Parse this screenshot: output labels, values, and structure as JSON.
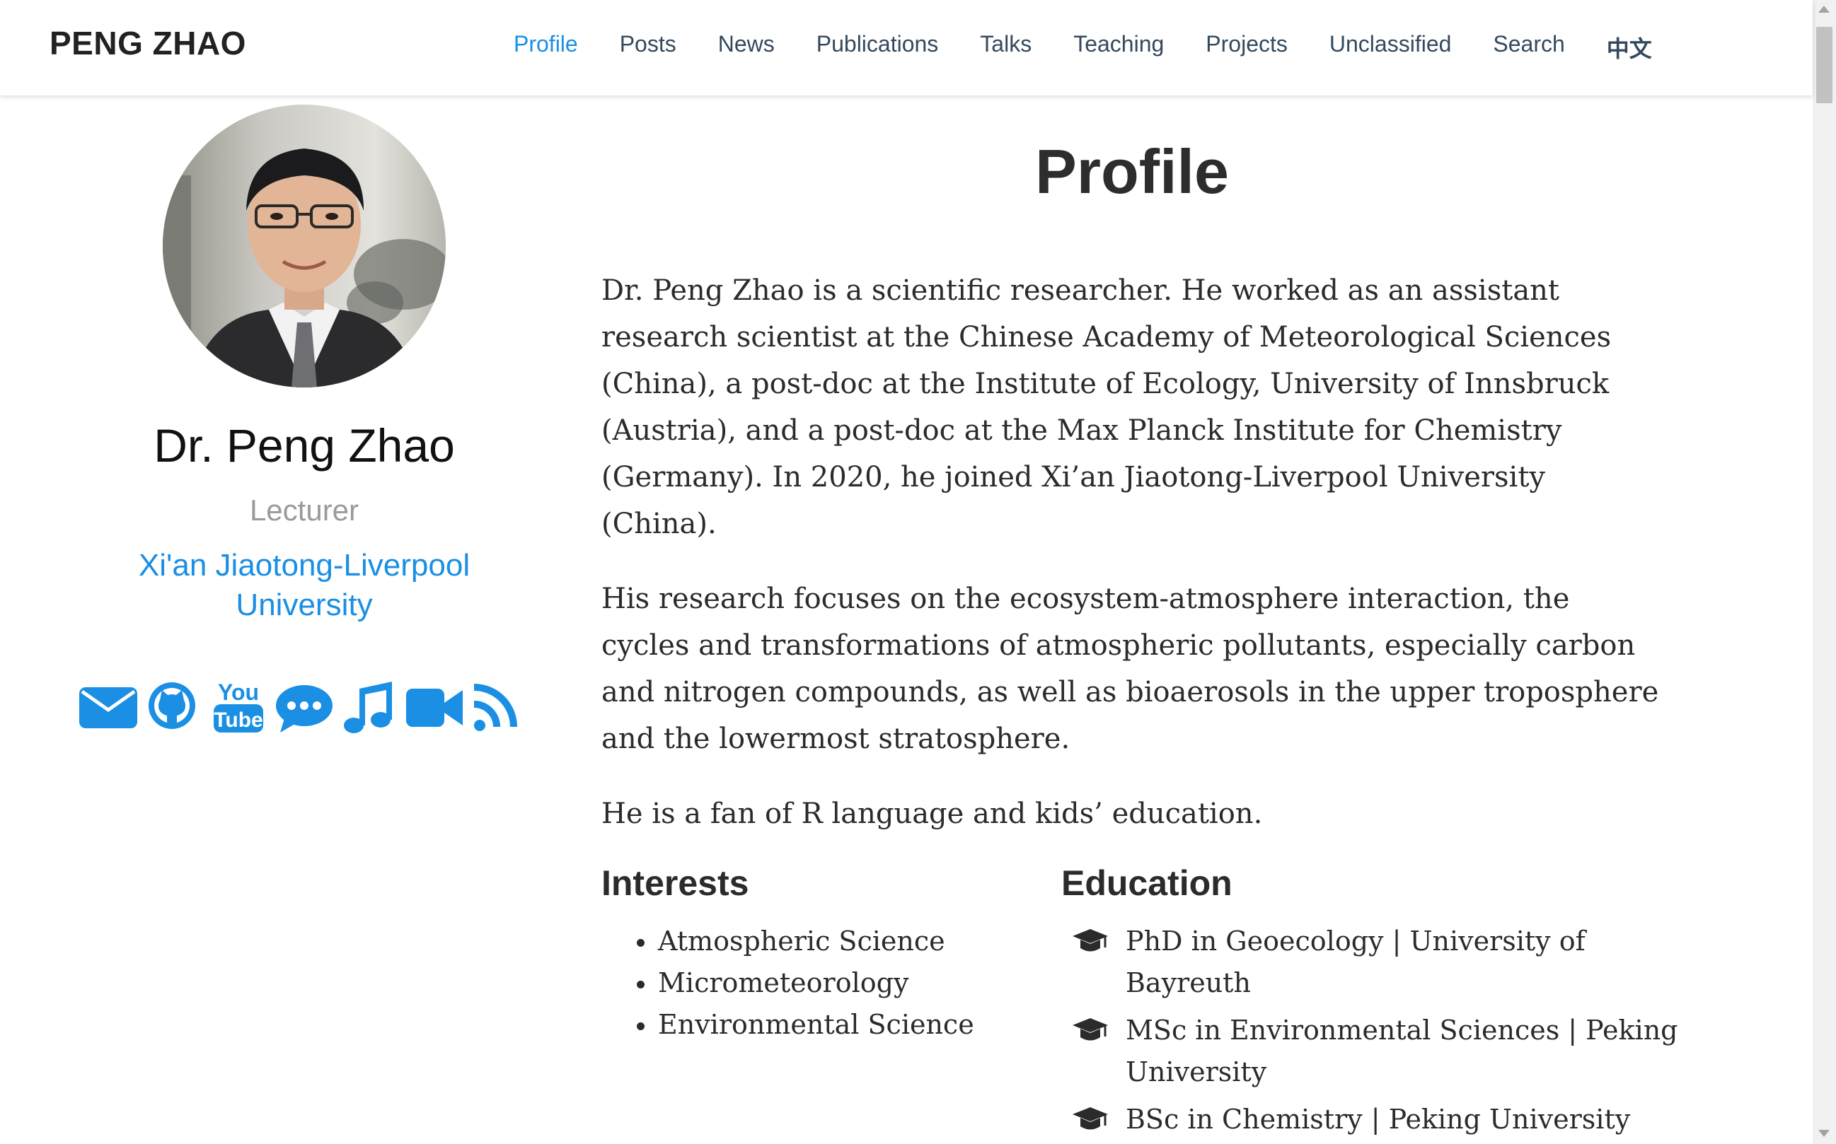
{
  "nav": {
    "brand": "PENG ZHAO",
    "items": [
      {
        "label": "Profile",
        "active": true
      },
      {
        "label": "Posts"
      },
      {
        "label": "News"
      },
      {
        "label": "Publications"
      },
      {
        "label": "Talks"
      },
      {
        "label": "Teaching"
      },
      {
        "label": "Projects"
      },
      {
        "label": "Unclassified"
      },
      {
        "label": "Search"
      },
      {
        "label": "中文"
      }
    ]
  },
  "profile": {
    "name": "Dr. Peng Zhao",
    "role": "Lecturer",
    "organization": "Xi'an Jiaotong-Liverpool University",
    "social_icons": [
      "envelope-icon",
      "github-icon",
      "youtube-icon",
      "comments-icon",
      "music-icon",
      "video-camera-icon",
      "rss-icon"
    ]
  },
  "main": {
    "title": "Profile",
    "bio": [
      "Dr. Peng Zhao is a scientific researcher. He worked as an assistant research scientist at the Chinese Academy of Meteorological Sciences (China), a post-doc at the Institute of Ecology, University of Innsbruck (Austria), and a post-doc at the Max Planck Institute for Chemistry (Germany). In 2020, he joined Xi’an Jiaotong-Liverpool University (China).",
      "His research focuses on the ecosystem-atmosphere interaction, the cycles and transformations of atmospheric pollutants, especially carbon and nitrogen compounds, as well as bioaerosols in the upper troposphere and the lowermost stratosphere.",
      "He is a fan of R language and kids’ education."
    ],
    "interests_heading": "Interests",
    "interests": [
      "Atmospheric Science",
      "Micrometeorology",
      "Environmental Science"
    ],
    "education_heading": "Education",
    "education": [
      "PhD in Geoecology | University of Bayreuth",
      "MSc in Environmental Sciences | Peking University",
      "BSc in Chemistry | Peking University"
    ]
  },
  "colors": {
    "accent": "#1a8fe3",
    "nav_text": "#34495e",
    "muted": "#9a9a9a"
  }
}
